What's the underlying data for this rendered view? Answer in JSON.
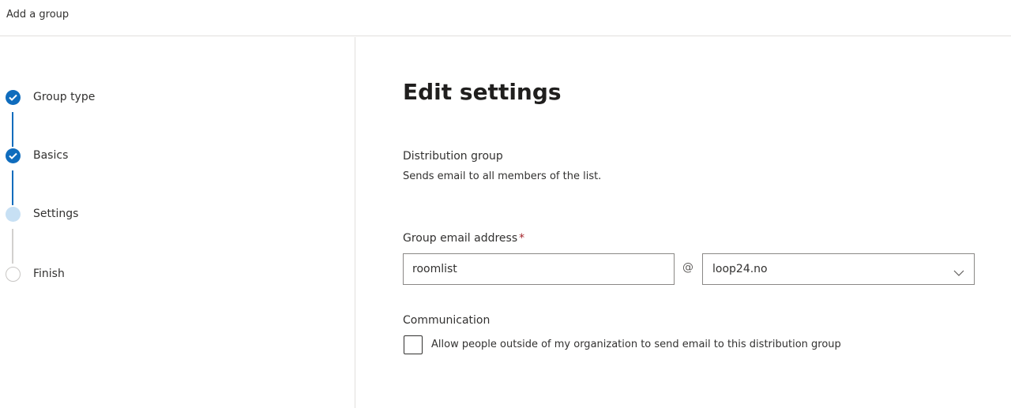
{
  "window": {
    "title": "Add a group"
  },
  "wizard": {
    "steps": [
      {
        "label": "Group type",
        "state": "completed"
      },
      {
        "label": "Basics",
        "state": "completed"
      },
      {
        "label": "Settings",
        "state": "current"
      },
      {
        "label": "Finish",
        "state": "pending"
      }
    ]
  },
  "main": {
    "heading": "Edit settings",
    "group_type": "Distribution group",
    "group_type_description": "Sends email to all members of the list.",
    "email": {
      "label": "Group email address",
      "required_marker": "*",
      "value": "roomlist",
      "at_symbol": "@",
      "domain": "loop24.no"
    },
    "communication": {
      "label": "Communication",
      "checkbox_label": "Allow people outside of my organization to send email to this distribution group",
      "checked": false
    }
  },
  "colors": {
    "accent": "#0f6cbd",
    "current_step": "#c7e0f4",
    "required": "#a4262c"
  },
  "icons": {
    "completed_step": "checkmark-icon",
    "dropdown": "chevron-down-icon"
  }
}
